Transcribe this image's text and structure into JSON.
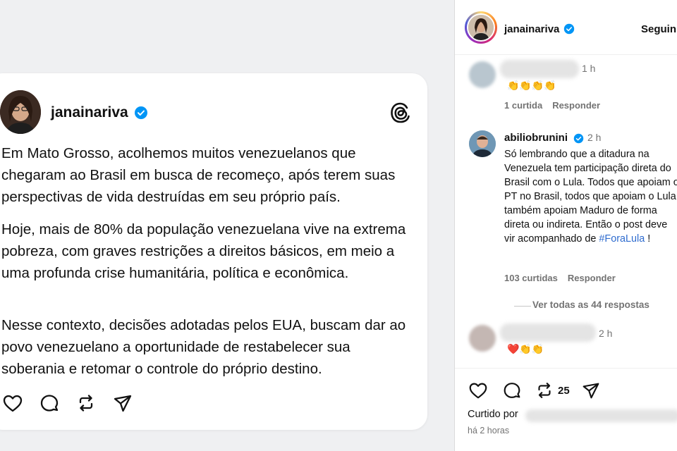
{
  "post_card": {
    "username": "janainariva",
    "paragraphs": [
      "Em Mato Grosso, acolhemos muitos venezuelanos que chegaram ao Brasil em busca de recomeço, após terem suas perspectivas de vida destruídas em seu próprio país.",
      "Hoje, mais de 80% da população venezuelana vive na extrema pobreza, com graves restrições a direitos básicos, em meio a uma profunda crise humanitária, política e econômica.",
      "Nesse contexto, decisões adotadas pelos EUA, buscam dar ao povo venezuelano a oportunidade de restabelecer sua soberania e retomar o controle do próprio destino."
    ],
    "actions": [
      "heart-icon",
      "comment-icon",
      "repost-icon",
      "share-icon"
    ]
  },
  "panel": {
    "header": {
      "username": "janainariva",
      "follow_label": "Seguin"
    },
    "comments": [
      {
        "time": "1 h",
        "emojis": "👏👏👏👏",
        "likes": "1 curtida",
        "reply_label": "Responder"
      },
      {
        "username": "abiliobrunini",
        "time": "2 h",
        "text": "Só lembrando que a ditadura na Venezuela tem participação direta do Brasil com o Lula. Todos que apoiam o PT no Brasil, todos que apoiam o Lula, também apoiam Maduro de forma direta ou indireta. Então o post deve vir acompanhado de ",
        "hashtag": "#ForaLula",
        "text_end": " !",
        "likes": "103 curtidas",
        "reply_label": "Responder",
        "view_replies": "Ver todas as 44 respostas"
      },
      {
        "time": "2 h",
        "emojis": "❤️👏👏"
      }
    ],
    "footer": {
      "repost_count": "25",
      "liked_by": "Curtido por",
      "time_ago": "há 2 horas"
    }
  },
  "colors": {
    "verified": "#0095f6",
    "hashtag": "#2f6ccf",
    "muted": "#737373"
  }
}
